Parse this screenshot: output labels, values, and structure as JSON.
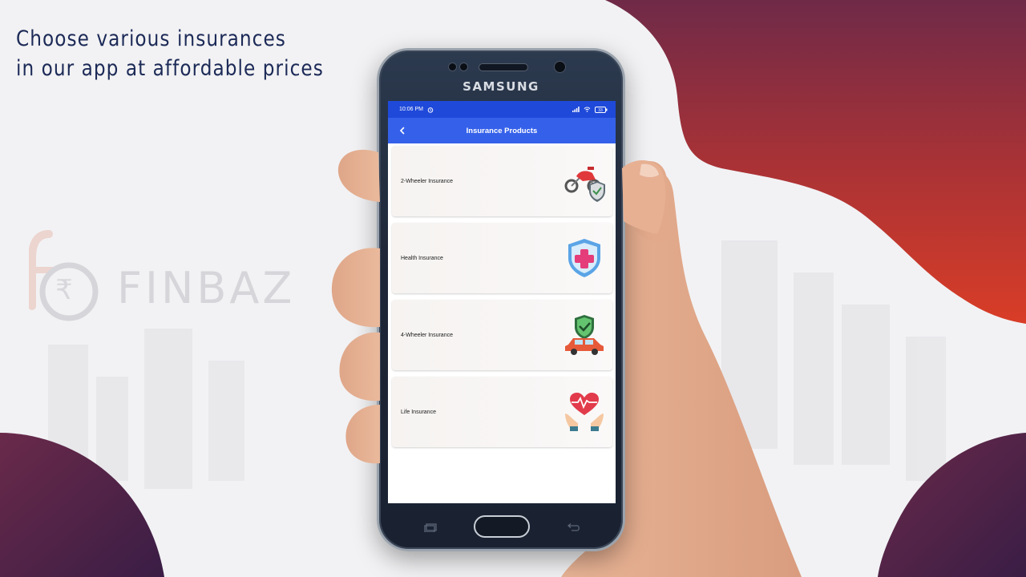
{
  "headline": {
    "line1": "Choose various insurances",
    "line2": "in our app at affordable prices"
  },
  "brand": {
    "name": "FINBAZ",
    "symbol": "₹"
  },
  "phone": {
    "brand": "SAMSUNG",
    "status_bar": {
      "time": "10:06 PM",
      "battery": "33"
    },
    "app_bar": {
      "back_icon": "chevron-left-icon",
      "title": "Insurance Products"
    },
    "products": [
      {
        "label": "2-Wheeler Insurance",
        "icon": "motorbike-shield-icon"
      },
      {
        "label": "Health Insurance",
        "icon": "medical-shield-icon"
      },
      {
        "label": "4-Wheeler Insurance",
        "icon": "car-shield-icon"
      },
      {
        "label": "Life Insurance",
        "icon": "heart-hands-icon"
      }
    ]
  },
  "colors": {
    "headline": "#1c2a57",
    "status_bar": "#1f49d9",
    "app_bar": "#3561ea",
    "blob_top": "#7a2a45",
    "blob_bottom": "#d63a28",
    "corner_blob": "#4e2145"
  }
}
